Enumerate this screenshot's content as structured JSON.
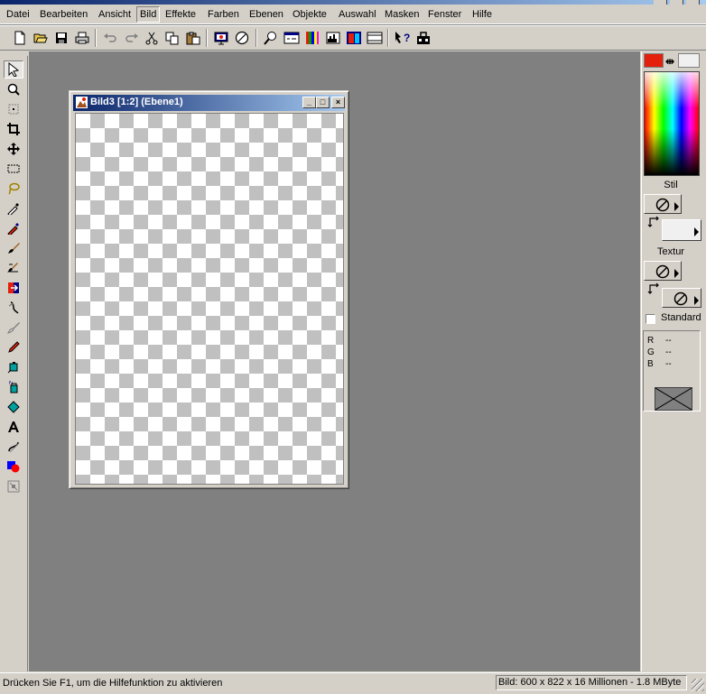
{
  "menu": {
    "items": [
      "Datei",
      "Bearbeiten",
      "Ansicht",
      "Bild",
      "Effekte",
      "Farben",
      "Ebenen",
      "Objekte",
      "Auswahl",
      "Masken",
      "Fenster",
      "Hilfe"
    ],
    "active": "Bild"
  },
  "toolbar": {
    "buttons": [
      "new-icon",
      "open-icon",
      "save-icon",
      "print-icon",
      "undo-icon",
      "redo-icon",
      "cut-icon",
      "copy-icon",
      "paste-icon",
      "screen-capture-icon",
      "browse-icon",
      "zoom-icon",
      "overview-icon",
      "colors-icon",
      "histogram-icon",
      "layers-icon",
      "toolbar-options-icon",
      "help-icon",
      "script-icon"
    ]
  },
  "tools": [
    "pointer-tool-icon",
    "zoom-tool-icon",
    "deform-tool-icon",
    "crop-tool-icon",
    "move-tool-icon",
    "selection-tool-icon",
    "lasso-tool-icon",
    "eyedropper-tool-icon",
    "dropper-tool-icon",
    "brush-tool-icon",
    "clone-tool-icon",
    "color-replacer-tool-icon",
    "retouch-tool-icon",
    "eraser-tool-icon",
    "smudge-tool-icon",
    "airbrush-tool-icon",
    "fill-tool-icon",
    "text-tool-icon",
    "line-tool-icon",
    "shape-tool-icon",
    "vector-tool-icon"
  ],
  "document": {
    "title": "Bild3 [1:2] (Ebene1)"
  },
  "palette": {
    "foreground_color": "#e2200c",
    "background_color": "#f0f0f0",
    "style_label": "Stil",
    "texture_label": "Textur",
    "standard_label": "Standard",
    "r_label": "R",
    "g_label": "G",
    "b_label": "B",
    "r_value": "--",
    "g_value": "--",
    "b_value": "--"
  },
  "status": {
    "left": "Drücken Sie F1, um die Hilfefunktion zu aktivieren",
    "right": "Bild:  600 x 822 x 16 Millionen - 1.8 MByte"
  }
}
